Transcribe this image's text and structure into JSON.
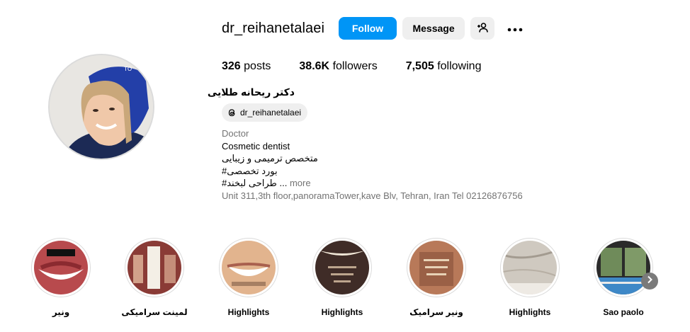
{
  "profile": {
    "username": "dr_reihanetalaei",
    "follow_label": "Follow",
    "message_label": "Message",
    "posts_count": "326",
    "posts_label": "posts",
    "followers_count": "38.6K",
    "followers_label": "followers",
    "following_count": "7,505",
    "following_label": "following",
    "full_name": "دکتر ریحانه طلایی",
    "threads_handle": "dr_reihanetalaei",
    "category": "Doctor",
    "bio_line1": "Cosmetic dentist",
    "bio_line2": "متخصص ترمیمی و زیبایی",
    "bio_line3": "بورد تخصصی#",
    "bio_line4": "... طراحی لبخند#",
    "bio_more": "more",
    "address": "Unit 311,3th floor,panoramaTower,kave Blv, Tehran, Iran Tel 02126876756",
    "avatar_icon": "profile-photo",
    "accent_color": "#0095f6"
  },
  "highlights": [
    {
      "label": "ونیر",
      "icon": "veneer-smile-thumb"
    },
    {
      "label": "لمینت سرامیکی",
      "icon": "ceramic-laminate-thumb"
    },
    {
      "label": "Highlights",
      "icon": "smile-thumb"
    },
    {
      "label": "Highlights",
      "icon": "teeth-text-thumb"
    },
    {
      "label": "ونیر سرامیک",
      "icon": "ceramic-veneer-thumb"
    },
    {
      "label": "Highlights",
      "icon": "marble-thumb"
    },
    {
      "label": "Sao paolo",
      "icon": "window-view-thumb"
    }
  ]
}
